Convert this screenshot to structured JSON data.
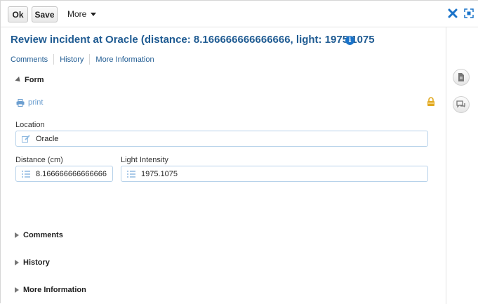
{
  "toolbar": {
    "ok_label": "Ok",
    "save_label": "Save",
    "more_label": "More"
  },
  "title": "Review incident at Oracle (distance: 8.166666666666666, light: 1975.1075",
  "links": [
    "Comments",
    "History",
    "More Information"
  ],
  "form": {
    "section_label": "Form",
    "print_label": "print",
    "location_label": "Location",
    "location_value": "Oracle",
    "distance_label": "Distance (cm)",
    "distance_value": "8.166666666666666",
    "light_label": "Light Intensity",
    "light_value": "1975.1075"
  },
  "sections": [
    "Comments",
    "History",
    "More Information"
  ],
  "icons": {
    "close": "close-icon",
    "maximize": "maximize-icon",
    "info": "info-icon",
    "print": "printer-icon",
    "lock": "lock-icon",
    "edit": "edit-icon",
    "list": "list-icon",
    "document": "document-icon",
    "chat": "chat-icon"
  },
  "colors": {
    "title": "#1f5b92",
    "link": "#1f5b92",
    "close": "#1a73c9",
    "field_border": "#b7d2ea",
    "lock": "#e0a820"
  }
}
